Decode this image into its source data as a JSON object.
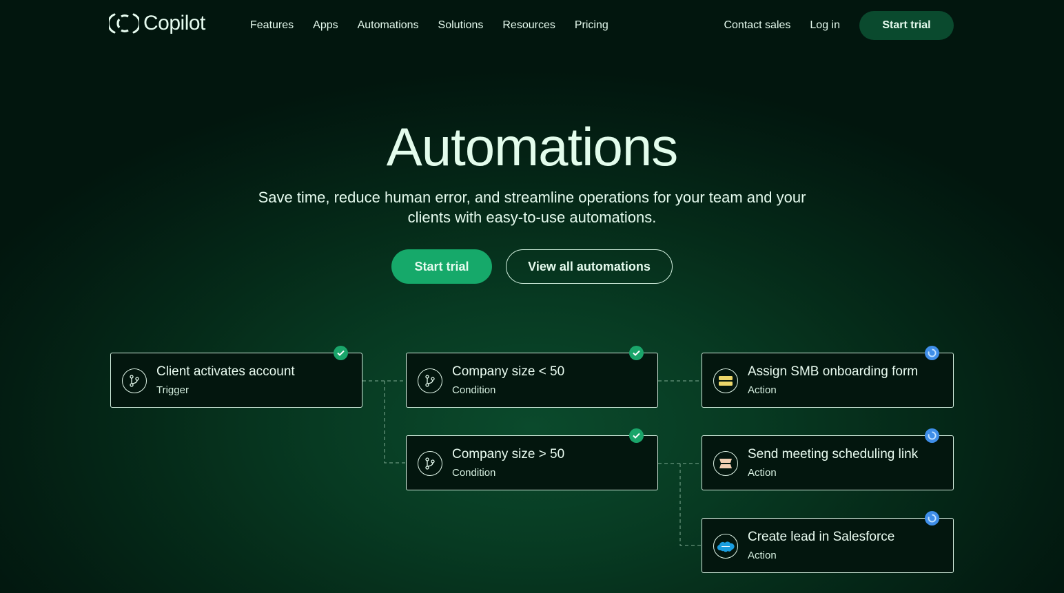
{
  "nav": {
    "brand": "Copilot",
    "links": [
      "Features",
      "Apps",
      "Automations",
      "Solutions",
      "Resources",
      "Pricing"
    ],
    "contact_sales": "Contact sales",
    "log_in": "Log in",
    "start_trial": "Start trial"
  },
  "hero": {
    "title": "Automations",
    "subtitle": "Save time, reduce human error, and streamline operations for your team and your clients with easy-to-use automations.",
    "primary_button": "Start trial",
    "secondary_button": "View all automations"
  },
  "flow": {
    "nodes": [
      {
        "id": "trigger",
        "title": "Client activates account",
        "type": "Trigger",
        "icon": "branch-icon",
        "status": "done"
      },
      {
        "id": "cond-lt",
        "title": "Company size < 50",
        "type": "Condition",
        "icon": "branch-icon",
        "status": "done"
      },
      {
        "id": "cond-gt",
        "title": "Company size > 50",
        "type": "Condition",
        "icon": "branch-icon",
        "status": "done"
      },
      {
        "id": "action-form",
        "title": "Assign SMB onboarding form",
        "type": "Action",
        "icon": "form-icon",
        "status": "pending"
      },
      {
        "id": "action-meeting",
        "title": "Send meeting scheduling link",
        "type": "Action",
        "icon": "calendar-stack-icon",
        "status": "pending"
      },
      {
        "id": "action-salesforce",
        "title": "Create lead in Salesforce",
        "type": "Action",
        "icon": "salesforce-icon",
        "status": "pending"
      }
    ]
  },
  "colors": {
    "accent": "#16a96a",
    "done_badge": "#1aa56a",
    "pending_badge": "#3f8ee8",
    "nav_button": "#0a4a2e",
    "text": "#e3fcec"
  }
}
